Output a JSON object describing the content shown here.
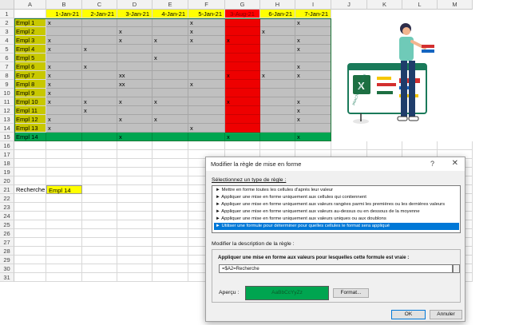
{
  "sheet": {
    "columns": [
      "A",
      "B",
      "C",
      "D",
      "E",
      "F",
      "G",
      "H",
      "I",
      "J",
      "K",
      "L",
      "M"
    ],
    "rows": [
      "1",
      "2",
      "3",
      "4",
      "5",
      "6",
      "7",
      "8",
      "9",
      "10",
      "11",
      "12",
      "13",
      "14",
      "15",
      "16",
      "17",
      "18",
      "19",
      "20",
      "21",
      "22",
      "23",
      "24",
      "25",
      "26",
      "27",
      "28",
      "29",
      "30",
      "31"
    ],
    "date_headers": [
      "1-Jan-21",
      "2-Jan-21",
      "3-Jan-21",
      "4-Jan-21",
      "5-Jan-21",
      "3-Aug-21",
      "6-Jan-21",
      "7-Jan-21"
    ],
    "employees": [
      "Empl 1",
      "Empl 2",
      "Empl 3",
      "Empl 4",
      "Empl 5",
      "Empl 6",
      "Empl 7",
      "Empl 8",
      "Empl 9",
      "Empl 10",
      "Empl 11",
      "Empl 12",
      "Empl 13",
      "Empl 14"
    ],
    "marks": [
      [
        "x",
        "",
        "",
        "",
        "x",
        "",
        "",
        "x"
      ],
      [
        "",
        "",
        "x",
        "",
        "x",
        "",
        "x",
        ""
      ],
      [
        "x",
        "",
        "x",
        "x",
        "x",
        "x",
        "",
        "x"
      ],
      [
        "x",
        "x",
        "",
        "",
        "",
        "",
        "",
        "x"
      ],
      [
        "",
        "",
        "",
        "x",
        "",
        "",
        "",
        ""
      ],
      [
        "x",
        "x",
        "",
        "",
        "",
        "",
        "",
        "x"
      ],
      [
        "x",
        "",
        "xx",
        "",
        "",
        "x",
        "x",
        "x"
      ],
      [
        "x",
        "",
        "xx",
        "",
        "x",
        "",
        "",
        ""
      ],
      [
        "x",
        "",
        "",
        "",
        "",
        "",
        "",
        ""
      ],
      [
        "x",
        "x",
        "x",
        "x",
        "",
        "x",
        "",
        "x"
      ],
      [
        "",
        "x",
        "",
        "",
        "",
        "",
        "",
        "x"
      ],
      [
        "x",
        "",
        "x",
        "x",
        "",
        "",
        "",
        "x"
      ],
      [
        "x",
        "",
        "",
        "",
        "x",
        "",
        "",
        ""
      ],
      [
        "",
        "",
        "x",
        "",
        "",
        "x",
        "",
        "x"
      ]
    ],
    "search_label": "Recherche",
    "search_value": "Empl 14",
    "colors": {
      "header_yellow": "#ffff00",
      "highlight_red": "#ee0000",
      "match_green": "#00a550",
      "marked_gray": "#c0c0c0",
      "name_olive": "#c8c800"
    }
  },
  "illustration": {
    "board_text": "PRACTICE EXCEL365"
  },
  "dialog": {
    "title": "Modifier la règle de mise en forme",
    "help": "?",
    "close": "✕",
    "select_type_label": "Sélectionnez un type de règle :",
    "rule_types": [
      "► Mettre en forme toutes les cellules d'après leur valeur",
      "► Appliquer une mise en forme uniquement aux cellules qui contiennent",
      "► Appliquer une mise en forme uniquement aux valeurs rangées parmi les premières ou les dernières valeurs",
      "► Appliquer une mise en forme uniquement aux valeurs au-dessus ou en dessous de la moyenne",
      "► Appliquer une mise en forme uniquement aux valeurs uniques ou aux doublons",
      "► Utiliser une formule pour déterminer pour quelles cellules le format sera appliqué"
    ],
    "selected_rule_index": 5,
    "description_label": "Modifier la description de la règle :",
    "formula_label": "Appliquer une mise en forme aux valeurs pour lesquelles cette formule est vraie :",
    "formula_value": "=$A2=Recherche",
    "preview_label": "Aperçu :",
    "preview_text": "AaBbCcYyZz",
    "format_button": "Format...",
    "ok_button": "OK",
    "cancel_button": "Annuler"
  }
}
